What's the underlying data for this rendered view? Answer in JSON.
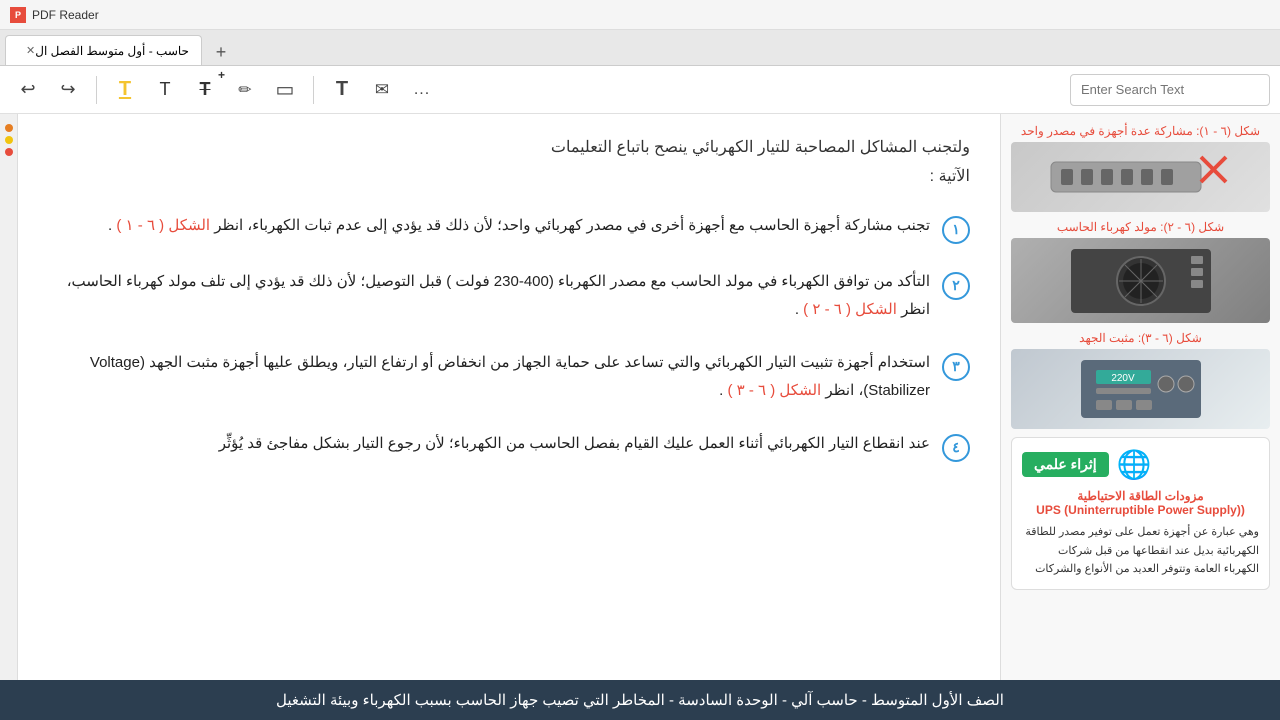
{
  "titlebar": {
    "app_name": "PDF Reader",
    "icon_label": "PDF"
  },
  "tabs": [
    {
      "label": "حاسب - أول متوسط الفصل ال",
      "active": true
    }
  ],
  "tab_add_label": "+",
  "toolbar": {
    "undo_label": "↩",
    "redo_label": "↪",
    "highlight_label": "T",
    "text_label": "T",
    "text_cross_label": "T",
    "pencil_label": "✏",
    "stamp_label": "▭",
    "text2_label": "T",
    "envelope_label": "✉",
    "more_label": "...",
    "search_placeholder": "Enter Search Text"
  },
  "content": {
    "intro_line1": "ولتجنب المشاكل المصاحبة للتيار الكهربائي ينصح باتباع التعليمات",
    "intro_line2": "الآتية :",
    "sections": [
      {
        "number": "١",
        "text_before": "تجنب مشاركة أجهزة الحاسب مع أجهزة أخرى في  مصدر كهربائي واحد؛ لأن ذلك قد يؤدي إلى عدم ثبات الكهرباء، انظر ",
        "link_text": "الشكل ( ٦ - ١ )",
        "text_after": " ."
      },
      {
        "number": "٢",
        "text_before": "التأكد من توافق الكهرباء في مولد الحاسب مع مصدر الكهرباء (400-230 فولت ) قبل التوصيل؛ لأن ذلك قد يؤدي إلى تلف مولد كهرباء الحاسب، انظر ",
        "link_text": "الشكل ( ٦ - ٢ )",
        "text_after": " ."
      },
      {
        "number": "٣",
        "text_before": "استخدام أجهزة تثبيت التيار الكهربائي والتي تساعد على حماية الجهاز من انخفاض أو ارتفاع التيار، ويطلق عليها أجهزة مثبت الجهد (Voltage Stabilizer)، انظر ",
        "link_text": "الشكل ( ٦ - ٣ )",
        "text_after": " ."
      },
      {
        "number": "٤",
        "text_before": "عند انقطاع التيار الكهربائي أثناء العمل عليك القيام بفصل الحاسب من الكهرباء؛ لأن رجوع التيار بشكل مفاجئ قد يُؤثِّر",
        "link_text": "",
        "text_after": ""
      }
    ],
    "figures": [
      {
        "label": "شكل (٦ - ١): مشاركة عدة أجهزة في مصدر واحد",
        "type": "power_strip"
      },
      {
        "label": "شكل (٦ - ٢): مولد كهرباء الحاسب",
        "type": "psu"
      },
      {
        "label": "شكل (٦ - ٣): مثبت الجهد",
        "type": "vreg"
      }
    ],
    "enrichment": {
      "button_label": "إثراء علمي",
      "title": "مزودات الطاقة الاحتياطية",
      "subtitle": "((UPS (Uninterruptible Power Supply",
      "body": "وهي عبارة عن أجهزة تعمل على توفير مصدر للطاقة الكهربائية بديل عند انقطاعها من قبل شركات الكهرباء العامة وتتوفر العديد من الأنواع والشركات"
    }
  },
  "status_bar": {
    "text": "الصف الأول المتوسط - حاسب آلي - الوحدة السادسة - المخاطر التي تصيب جهاز الحاسب بسبب الكهرباء وبيئة التشغيل"
  }
}
